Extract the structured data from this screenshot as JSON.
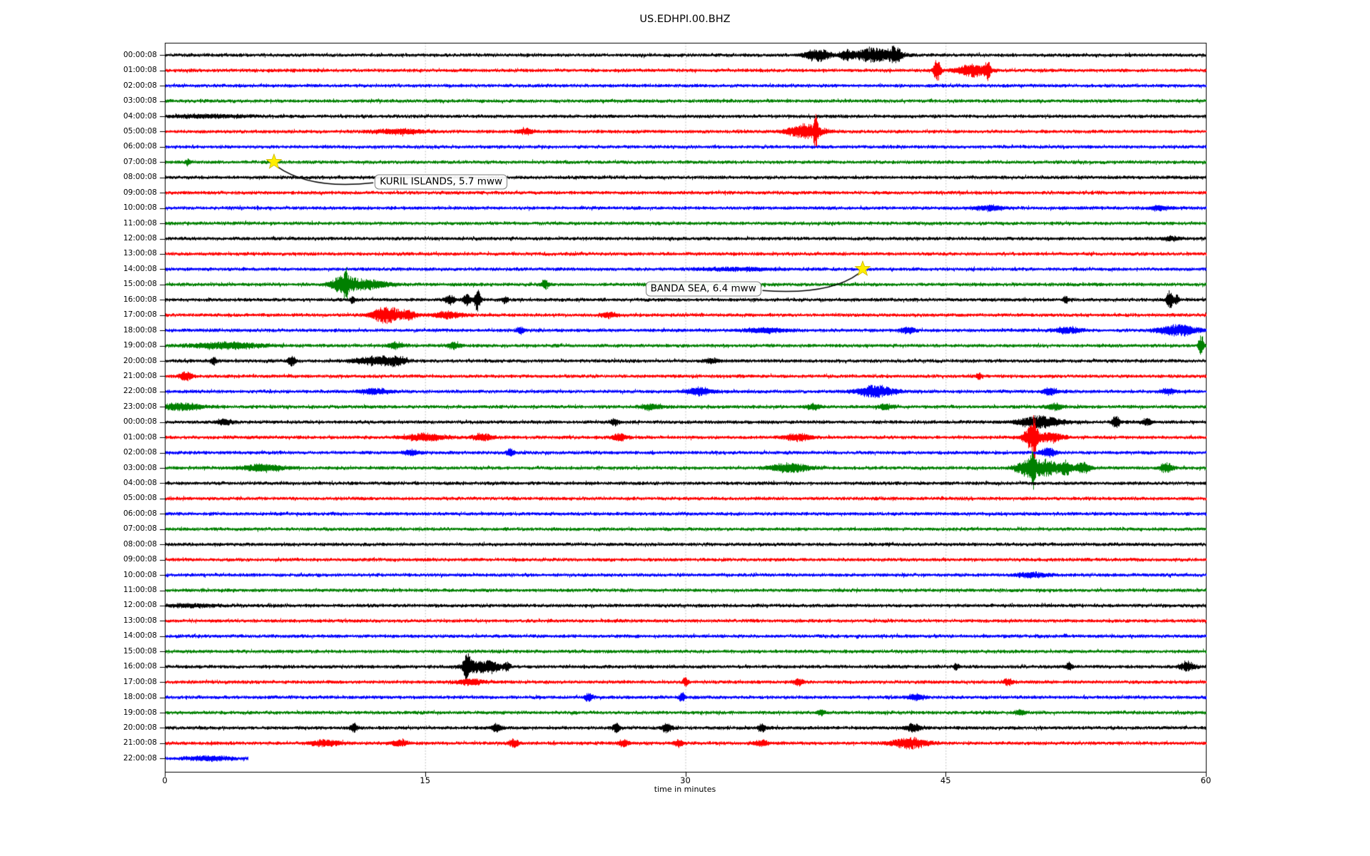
{
  "chart_data": {
    "type": "line",
    "title": "US.EDHPI.00.BHZ",
    "xlabel": "time in minutes",
    "xlim": [
      0,
      60
    ],
    "xticks": [
      0,
      15,
      30,
      45,
      60
    ],
    "xtick_labels": [
      "0",
      "15",
      "30",
      "45",
      "60"
    ],
    "xgrid_minutes": [
      15,
      30,
      45
    ],
    "grid_style": "dotted",
    "trace_colors": [
      "#000000",
      "#ff0000",
      "#0000ff",
      "#008000"
    ],
    "star_color": "#ffee00",
    "rows": [
      {
        "label": "00:00:08",
        "color": "#000000",
        "extent": 60,
        "events": [
          [
            37.6,
            0.5,
            7
          ],
          [
            39.3,
            0.25,
            5
          ],
          [
            40.9,
            0.8,
            8
          ],
          [
            42.1,
            0.25,
            7
          ]
        ]
      },
      {
        "label": "01:00:08",
        "color": "#ff0000",
        "extent": 60,
        "events": [
          [
            44.5,
            0.15,
            13
          ],
          [
            46.5,
            0.6,
            7
          ],
          [
            47.4,
            0.12,
            9
          ]
        ]
      },
      {
        "label": "02:00:08",
        "color": "#0000ff",
        "extent": 60,
        "events": []
      },
      {
        "label": "03:00:08",
        "color": "#008000",
        "extent": 60,
        "events": []
      },
      {
        "label": "04:00:08",
        "color": "#000000",
        "extent": 60,
        "events": [
          [
            2.5,
            1.5,
            1.5
          ]
        ]
      },
      {
        "label": "05:00:08",
        "color": "#ff0000",
        "extent": 60,
        "events": [
          [
            13.5,
            1,
            2.5
          ],
          [
            20.8,
            0.3,
            3
          ],
          [
            36.9,
            0.7,
            8
          ],
          [
            37.5,
            0.08,
            18
          ]
        ]
      },
      {
        "label": "06:00:08",
        "color": "#0000ff",
        "extent": 60,
        "events": []
      },
      {
        "label": "07:00:08",
        "color": "#008000",
        "extent": 60,
        "events": [
          [
            1.3,
            0.1,
            4
          ]
        ]
      },
      {
        "label": "08:00:08",
        "color": "#000000",
        "extent": 60,
        "events": []
      },
      {
        "label": "09:00:08",
        "color": "#ff0000",
        "extent": 60,
        "events": []
      },
      {
        "label": "10:00:08",
        "color": "#0000ff",
        "extent": 60,
        "events": [
          [
            47.5,
            0.6,
            2.5
          ],
          [
            57.3,
            0.4,
            2.5
          ]
        ]
      },
      {
        "label": "11:00:08",
        "color": "#008000",
        "extent": 60,
        "events": []
      },
      {
        "label": "12:00:08",
        "color": "#000000",
        "extent": 60,
        "events": [
          [
            58,
            0.4,
            2
          ]
        ]
      },
      {
        "label": "13:00:08",
        "color": "#ff0000",
        "extent": 60,
        "events": []
      },
      {
        "label": "14:00:08",
        "color": "#0000ff",
        "extent": 60,
        "events": [
          [
            33,
            1.5,
            1.5
          ]
        ]
      },
      {
        "label": "15:00:08",
        "color": "#008000",
        "extent": 60,
        "events": [
          [
            10.3,
            0.5,
            9
          ],
          [
            10.4,
            0.07,
            16
          ],
          [
            11.7,
            0.8,
            5
          ],
          [
            21.9,
            0.15,
            5
          ]
        ]
      },
      {
        "label": "16:00:08",
        "color": "#000000",
        "extent": 60,
        "events": [
          [
            10.8,
            0.1,
            4
          ],
          [
            16.4,
            0.2,
            5
          ],
          [
            17.4,
            0.15,
            6
          ],
          [
            18,
            0.12,
            13
          ],
          [
            19.6,
            0.1,
            4
          ],
          [
            51.9,
            0.1,
            5
          ],
          [
            57.9,
            0.12,
            11
          ],
          [
            58.3,
            0.1,
            5
          ]
        ]
      },
      {
        "label": "17:00:08",
        "color": "#ff0000",
        "extent": 60,
        "events": [
          [
            12.8,
            0.6,
            9
          ],
          [
            14.1,
            0.3,
            4
          ],
          [
            16.3,
            0.6,
            3.5
          ],
          [
            25.6,
            0.3,
            3
          ]
        ]
      },
      {
        "label": "18:00:08",
        "color": "#0000ff",
        "extent": 60,
        "events": [
          [
            20.5,
            0.15,
            3.5
          ],
          [
            34.6,
            0.8,
            2.5
          ],
          [
            42.8,
            0.3,
            3.5
          ],
          [
            52,
            0.5,
            3.5
          ],
          [
            58.4,
            0.8,
            6
          ]
        ]
      },
      {
        "label": "19:00:08",
        "color": "#008000",
        "extent": 60,
        "events": [
          [
            3.6,
            1.4,
            3.5
          ],
          [
            13.3,
            0.3,
            3.5
          ],
          [
            16.7,
            0.25,
            4
          ],
          [
            59.7,
            0.1,
            13
          ]
        ]
      },
      {
        "label": "20:00:08",
        "color": "#000000",
        "extent": 60,
        "events": [
          [
            2.8,
            0.12,
            4
          ],
          [
            7.3,
            0.15,
            6
          ],
          [
            12.1,
            0.8,
            4.5
          ],
          [
            13.3,
            0.4,
            4.5
          ],
          [
            31.5,
            0.3,
            2.5
          ]
        ]
      },
      {
        "label": "21:00:08",
        "color": "#ff0000",
        "extent": 60,
        "events": [
          [
            1.2,
            0.25,
            5
          ],
          [
            46.9,
            0.1,
            4
          ]
        ]
      },
      {
        "label": "22:00:08",
        "color": "#0000ff",
        "extent": 60,
        "events": [
          [
            12.1,
            0.6,
            3
          ],
          [
            30.8,
            0.5,
            4
          ],
          [
            41,
            0.7,
            7
          ],
          [
            51,
            0.3,
            4
          ],
          [
            57.8,
            0.3,
            3
          ]
        ]
      },
      {
        "label": "23:00:08",
        "color": "#008000",
        "extent": 60,
        "events": [
          [
            0.9,
            0.8,
            4
          ],
          [
            28,
            0.4,
            3
          ],
          [
            37.4,
            0.3,
            3
          ],
          [
            41.5,
            0.3,
            3
          ],
          [
            51.3,
            0.3,
            3.5
          ]
        ]
      },
      {
        "label": "00:00:08",
        "color": "#000000",
        "extent": 60,
        "events": [
          [
            3.4,
            0.3,
            3
          ],
          [
            25.9,
            0.15,
            4
          ],
          [
            50.4,
            0.8,
            7
          ],
          [
            54.8,
            0.15,
            8
          ],
          [
            56.6,
            0.2,
            4
          ]
        ]
      },
      {
        "label": "01:00:08",
        "color": "#ff0000",
        "extent": 60,
        "events": [
          [
            15,
            0.8,
            4
          ],
          [
            18.3,
            0.4,
            4
          ],
          [
            26.2,
            0.3,
            4
          ],
          [
            36.5,
            0.5,
            4
          ],
          [
            49.9,
            0.3,
            12
          ],
          [
            50.1,
            0.08,
            22
          ],
          [
            51,
            0.5,
            5
          ]
        ]
      },
      {
        "label": "02:00:08",
        "color": "#0000ff",
        "extent": 60,
        "events": [
          [
            14.2,
            0.3,
            3
          ],
          [
            19.9,
            0.15,
            4
          ],
          [
            50.9,
            0.3,
            5
          ]
        ]
      },
      {
        "label": "03:00:08",
        "color": "#008000",
        "extent": 60,
        "events": [
          [
            5.6,
            0.8,
            4
          ],
          [
            36,
            0.8,
            5
          ],
          [
            49.8,
            0.5,
            10
          ],
          [
            50,
            0.08,
            20
          ],
          [
            50.9,
            0.4,
            8
          ],
          [
            51.9,
            0.25,
            8
          ],
          [
            52.9,
            0.3,
            6
          ],
          [
            57.7,
            0.25,
            5
          ]
        ]
      },
      {
        "label": "04:00:08",
        "color": "#000000",
        "extent": 60,
        "events": []
      },
      {
        "label": "05:00:08",
        "color": "#ff0000",
        "extent": 60,
        "events": []
      },
      {
        "label": "06:00:08",
        "color": "#0000ff",
        "extent": 60,
        "events": []
      },
      {
        "label": "07:00:08",
        "color": "#008000",
        "extent": 60,
        "events": []
      },
      {
        "label": "08:00:08",
        "color": "#000000",
        "extent": 60,
        "events": []
      },
      {
        "label": "09:00:08",
        "color": "#ff0000",
        "extent": 60,
        "events": []
      },
      {
        "label": "10:00:08",
        "color": "#0000ff",
        "extent": 60,
        "events": [
          [
            50,
            0.6,
            2.5
          ]
        ]
      },
      {
        "label": "11:00:08",
        "color": "#008000",
        "extent": 60,
        "events": []
      },
      {
        "label": "12:00:08",
        "color": "#000000",
        "extent": 60,
        "events": [
          [
            1.5,
            1,
            1.5
          ]
        ]
      },
      {
        "label": "13:00:08",
        "color": "#ff0000",
        "extent": 60,
        "events": []
      },
      {
        "label": "14:00:08",
        "color": "#0000ff",
        "extent": 60,
        "events": []
      },
      {
        "label": "15:00:08",
        "color": "#008000",
        "extent": 60,
        "events": []
      },
      {
        "label": "16:00:08",
        "color": "#000000",
        "extent": 60,
        "events": [
          [
            17.4,
            0.15,
            12
          ],
          [
            17.9,
            0.5,
            6
          ],
          [
            18.8,
            0.4,
            5
          ],
          [
            19.7,
            0.12,
            5
          ],
          [
            45.6,
            0.1,
            3.5
          ],
          [
            52.1,
            0.12,
            4.5
          ],
          [
            58.9,
            0.3,
            5
          ]
        ]
      },
      {
        "label": "17:00:08",
        "color": "#ff0000",
        "extent": 60,
        "events": [
          [
            17.6,
            0.5,
            3.5
          ],
          [
            30,
            0.1,
            5
          ],
          [
            36.5,
            0.2,
            3.5
          ],
          [
            48.6,
            0.2,
            3.5
          ]
        ]
      },
      {
        "label": "18:00:08",
        "color": "#0000ff",
        "extent": 60,
        "events": [
          [
            24.4,
            0.15,
            5
          ],
          [
            29.8,
            0.12,
            5
          ],
          [
            43.3,
            0.3,
            3.5
          ]
        ]
      },
      {
        "label": "19:00:08",
        "color": "#008000",
        "extent": 60,
        "events": [
          [
            37.8,
            0.15,
            3.5
          ],
          [
            49.3,
            0.2,
            3
          ]
        ]
      },
      {
        "label": "20:00:08",
        "color": "#000000",
        "extent": 60,
        "events": [
          [
            10.9,
            0.15,
            4.5
          ],
          [
            19.1,
            0.2,
            4.5
          ],
          [
            26,
            0.15,
            5
          ],
          [
            28.9,
            0.2,
            5
          ],
          [
            34.4,
            0.15,
            4.5
          ],
          [
            43.1,
            0.3,
            4.5
          ]
        ]
      },
      {
        "label": "21:00:08",
        "color": "#ff0000",
        "extent": 60,
        "events": [
          [
            9.3,
            0.6,
            3.5
          ],
          [
            13.5,
            0.3,
            3.5
          ],
          [
            20.1,
            0.2,
            4.5
          ],
          [
            26.4,
            0.2,
            4
          ],
          [
            29.6,
            0.2,
            3.5
          ],
          [
            34.3,
            0.3,
            3
          ],
          [
            42.9,
            0.7,
            6
          ]
        ]
      },
      {
        "label": "22:00:08",
        "color": "#0000ff",
        "extent": 4.8,
        "events": [
          [
            2.5,
            0.8,
            2.5
          ]
        ]
      }
    ],
    "annotations": [
      {
        "text": "KURIL ISLANDS, 5.7 mww",
        "star": {
          "row": 7,
          "minute": 6.3
        },
        "box": {
          "row": 8.3,
          "minute": 12.1
        }
      },
      {
        "text": "BANDA SEA, 6.4 mww",
        "star": {
          "row": 14,
          "minute": 40.2
        },
        "box": {
          "row": 15.3,
          "minute": 27.7
        }
      }
    ]
  }
}
